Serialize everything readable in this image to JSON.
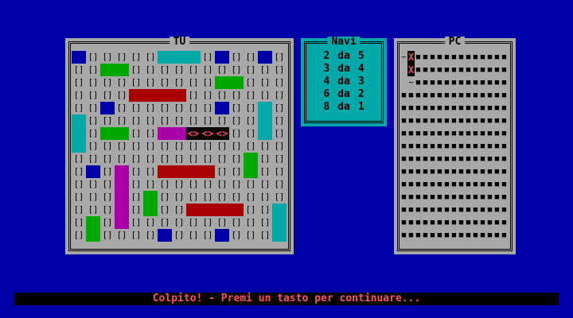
{
  "player_panel": {
    "title": "TU",
    "empty_cell": "[]",
    "hit_cell": "<>",
    "rows": 15,
    "cols": 15,
    "ship_colors": {
      "blue": "#0000a8",
      "green": "#00a800",
      "cyan": "#00a8a8",
      "red": "#a80000",
      "magenta": "#a800a8"
    },
    "ships": [
      {
        "color": "blue",
        "row": 0,
        "col": 0,
        "len": 1,
        "dir": "h"
      },
      {
        "color": "cyan",
        "row": 0,
        "col": 6,
        "len": 3,
        "dir": "h"
      },
      {
        "color": "blue",
        "row": 0,
        "col": 10,
        "len": 1,
        "dir": "h"
      },
      {
        "color": "blue",
        "row": 0,
        "col": 13,
        "len": 1,
        "dir": "h"
      },
      {
        "color": "green",
        "row": 1,
        "col": 2,
        "len": 2,
        "dir": "h"
      },
      {
        "color": "green",
        "row": 2,
        "col": 10,
        "len": 2,
        "dir": "h"
      },
      {
        "color": "red",
        "row": 3,
        "col": 4,
        "len": 4,
        "dir": "h"
      },
      {
        "color": "blue",
        "row": 4,
        "col": 2,
        "len": 1,
        "dir": "h"
      },
      {
        "color": "blue",
        "row": 4,
        "col": 10,
        "len": 1,
        "dir": "h"
      },
      {
        "color": "cyan",
        "row": 4,
        "col": 13,
        "len": 3,
        "dir": "v"
      },
      {
        "color": "cyan",
        "row": 5,
        "col": 0,
        "len": 3,
        "dir": "v"
      },
      {
        "color": "green",
        "row": 6,
        "col": 2,
        "len": 2,
        "dir": "h"
      },
      {
        "color": "magenta",
        "row": 6,
        "col": 6,
        "len": 2,
        "dir": "h"
      },
      {
        "color": "green",
        "row": 8,
        "col": 12,
        "len": 2,
        "dir": "v"
      },
      {
        "color": "blue",
        "row": 9,
        "col": 1,
        "len": 1,
        "dir": "h"
      },
      {
        "color": "magenta",
        "row": 9,
        "col": 3,
        "len": 5,
        "dir": "v"
      },
      {
        "color": "red",
        "row": 9,
        "col": 6,
        "len": 4,
        "dir": "h"
      },
      {
        "color": "green",
        "row": 11,
        "col": 5,
        "len": 2,
        "dir": "v"
      },
      {
        "color": "red",
        "row": 12,
        "col": 8,
        "len": 4,
        "dir": "h"
      },
      {
        "color": "cyan",
        "row": 12,
        "col": 14,
        "len": 3,
        "dir": "v"
      },
      {
        "color": "green",
        "row": 13,
        "col": 1,
        "len": 2,
        "dir": "v"
      },
      {
        "color": "blue",
        "row": 14,
        "col": 6,
        "len": 1,
        "dir": "h"
      },
      {
        "color": "blue",
        "row": 14,
        "col": 10,
        "len": 1,
        "dir": "h"
      }
    ],
    "hits": [
      {
        "row": 6,
        "col": 8
      },
      {
        "row": 6,
        "col": 9
      },
      {
        "row": 6,
        "col": 10
      }
    ]
  },
  "navi_panel": {
    "title": "Navi",
    "rows": [
      {
        "count": "2",
        "sep": "da",
        "size": "5"
      },
      {
        "count": "3",
        "sep": "da",
        "size": "4"
      },
      {
        "count": "4",
        "sep": "da",
        "size": "3"
      },
      {
        "count": "6",
        "sep": "da",
        "size": "2"
      },
      {
        "count": "8",
        "sep": "da",
        "size": "1"
      }
    ]
  },
  "pc_panel": {
    "title": "PC",
    "unknown_cell": "■",
    "miss_cell": "~",
    "hit_cell": "X",
    "rows": 15,
    "cols": 15,
    "misses": [
      {
        "row": 0,
        "col": 0
      },
      {
        "row": 2,
        "col": 1
      }
    ],
    "hits": [
      {
        "row": 0,
        "col": 1
      },
      {
        "row": 1,
        "col": 1
      }
    ],
    "blanks": [
      {
        "row": 1,
        "col": 0
      },
      {
        "row": 2,
        "col": 0
      }
    ]
  },
  "status_bar": {
    "message": "Colpito! - Premi un tasto per continuare..."
  }
}
